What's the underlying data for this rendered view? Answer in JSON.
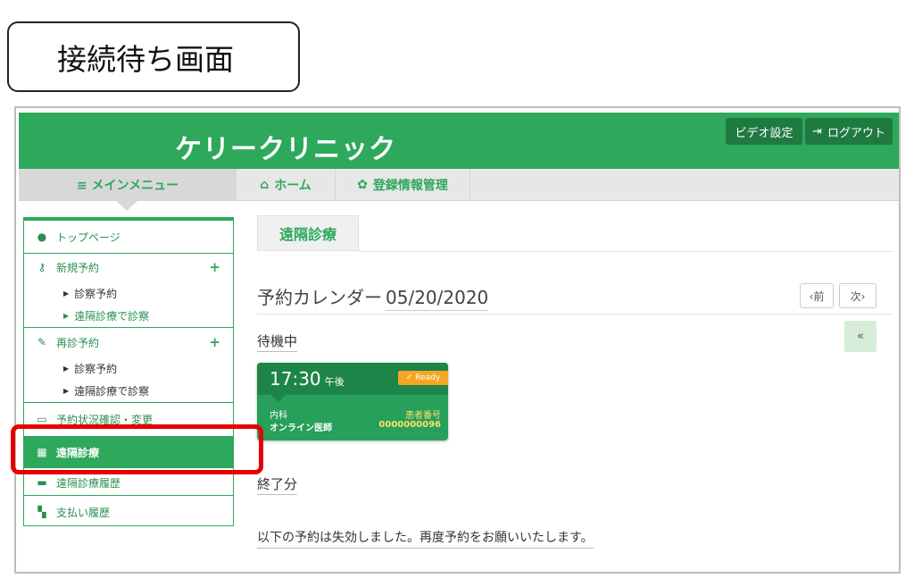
{
  "caption": "接続待ち画面",
  "header": {
    "brand": "ケリークリニック",
    "video_settings": "ビデオ設定",
    "logout": "ログアウト"
  },
  "nav": {
    "main_menu": "≡ メインメニュー",
    "home": "ホーム",
    "registration": "登録情報管理"
  },
  "sidebar": {
    "top_page": "トップページ",
    "new_reservation": {
      "label": "新規予約",
      "items": [
        "診察予約",
        "遠隔診療で診察"
      ]
    },
    "re_reservation": {
      "label": "再診予約",
      "items": [
        "診察予約",
        "遠隔診療で診察"
      ]
    },
    "reservation_status": "予約状況確認・変更",
    "telemedicine": "遠隔診療",
    "telemedicine_history": "遠隔診療履歴",
    "payment_history": "支払い履歴"
  },
  "main": {
    "tab": "遠隔診療",
    "calendar_title": "予約カレンダー",
    "calendar_date": "05/20/2020",
    "prev": "‹前",
    "next": "次›",
    "collapse": "«",
    "waiting_label": "待機中",
    "finished_label": "終了分",
    "expired_message": "以下の予約は失効しました。再度予約をお願いいたします。"
  },
  "appointment": {
    "time": "17:30",
    "ampm": "午後",
    "status": "✓ Ready",
    "department": "内科",
    "doctor": "オンライン医師",
    "patient_label": "患者番号",
    "patient_number": "0000000096"
  },
  "colors": {
    "brand_green": "#2ea85b",
    "dark_green": "#1d8548",
    "ready_orange": "#f5a623",
    "highlight_red": "#e60000"
  }
}
